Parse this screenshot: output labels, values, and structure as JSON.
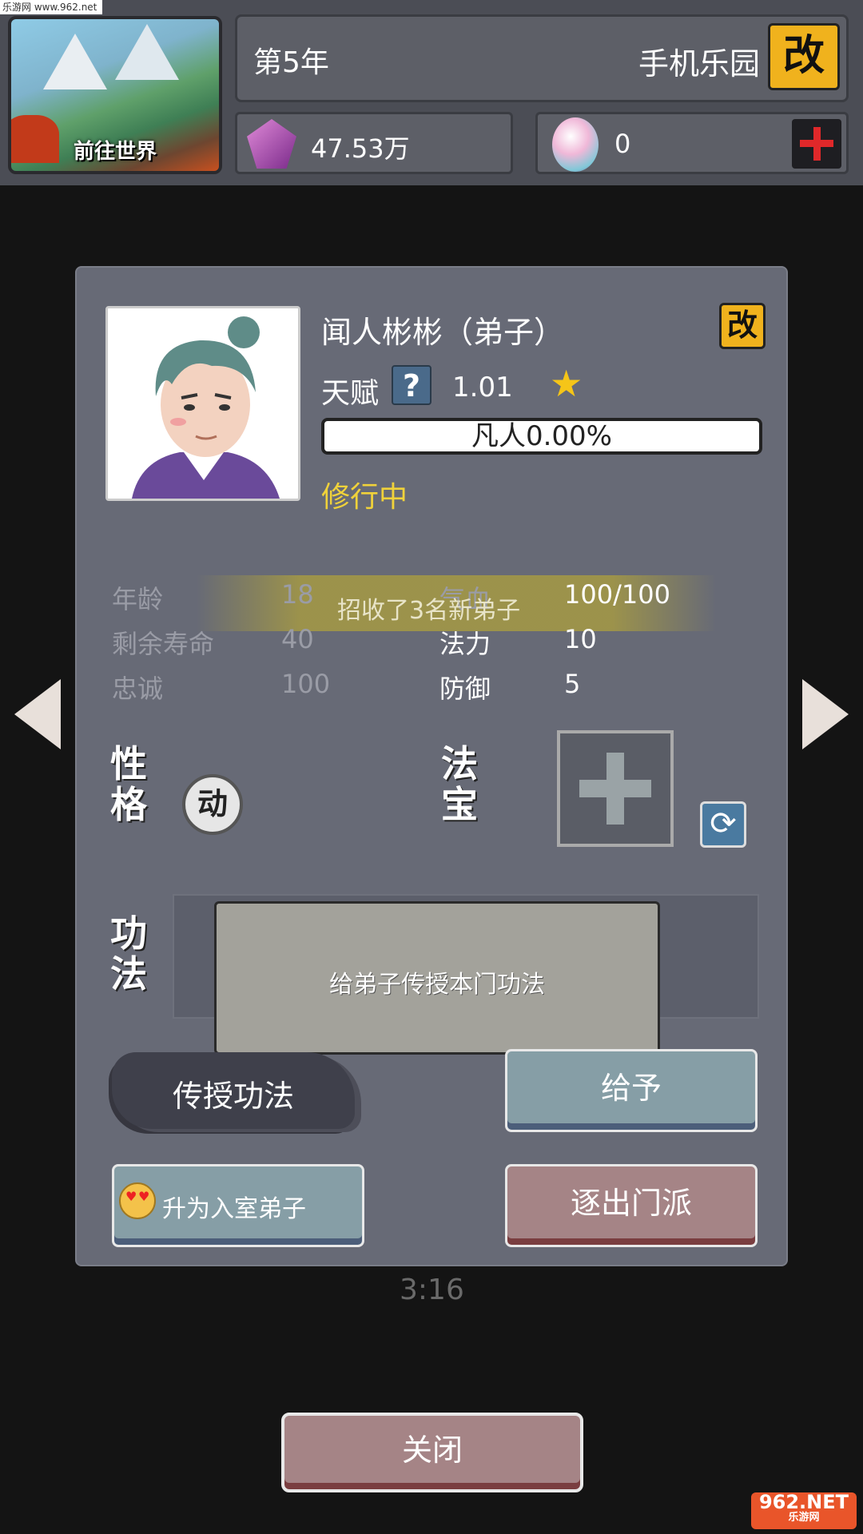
{
  "watermark_top": "乐游网 www.962.net",
  "world_button": {
    "label": "前往世界"
  },
  "header": {
    "year": "第5年",
    "sect_name": "手机乐园",
    "rename_label": "改"
  },
  "resources": {
    "spirit_stone": {
      "icon": "crystal-icon",
      "value": "47.53万"
    },
    "spirit_egg": {
      "icon": "egg-gem-icon",
      "value": "0"
    }
  },
  "disciple": {
    "name": "闻人彬彬（弟子）",
    "rename_label": "改",
    "talent_label": "天赋",
    "talent_help": "?",
    "talent_value": "1.01",
    "realm_progress": "凡人0.00%",
    "status": "修行中",
    "stats": {
      "age_label": "年龄",
      "age_value": "18",
      "life_label": "剩余寿命",
      "life_value": "40",
      "loyalty_label": "忠诚",
      "loyalty_value": "100",
      "hp_label": "气血",
      "hp_value": "100/100",
      "mana_label": "法力",
      "mana_value": "10",
      "defense_label": "防御",
      "defense_value": "5"
    },
    "personality_label": "性格",
    "personality_value": "动",
    "treasure_label": "法宝",
    "technique_label": "功法"
  },
  "toast": "招收了3名新弟子",
  "tooltip": "给弟子传授本门功法",
  "buttons": {
    "teach": "传授功法",
    "give": "给予",
    "promote": "升为入室弟子",
    "expel": "逐出门派",
    "close": "关闭"
  },
  "timer": "3:16",
  "watermark_bottom": {
    "brand": "962.NET",
    "sub": "乐游网"
  },
  "colors": {
    "accent_gold": "#f0b21d",
    "status_yellow": "#f0d23a",
    "star": "#f5c518",
    "expel_rose": "#a58486",
    "give_teal": "#869ea6"
  }
}
